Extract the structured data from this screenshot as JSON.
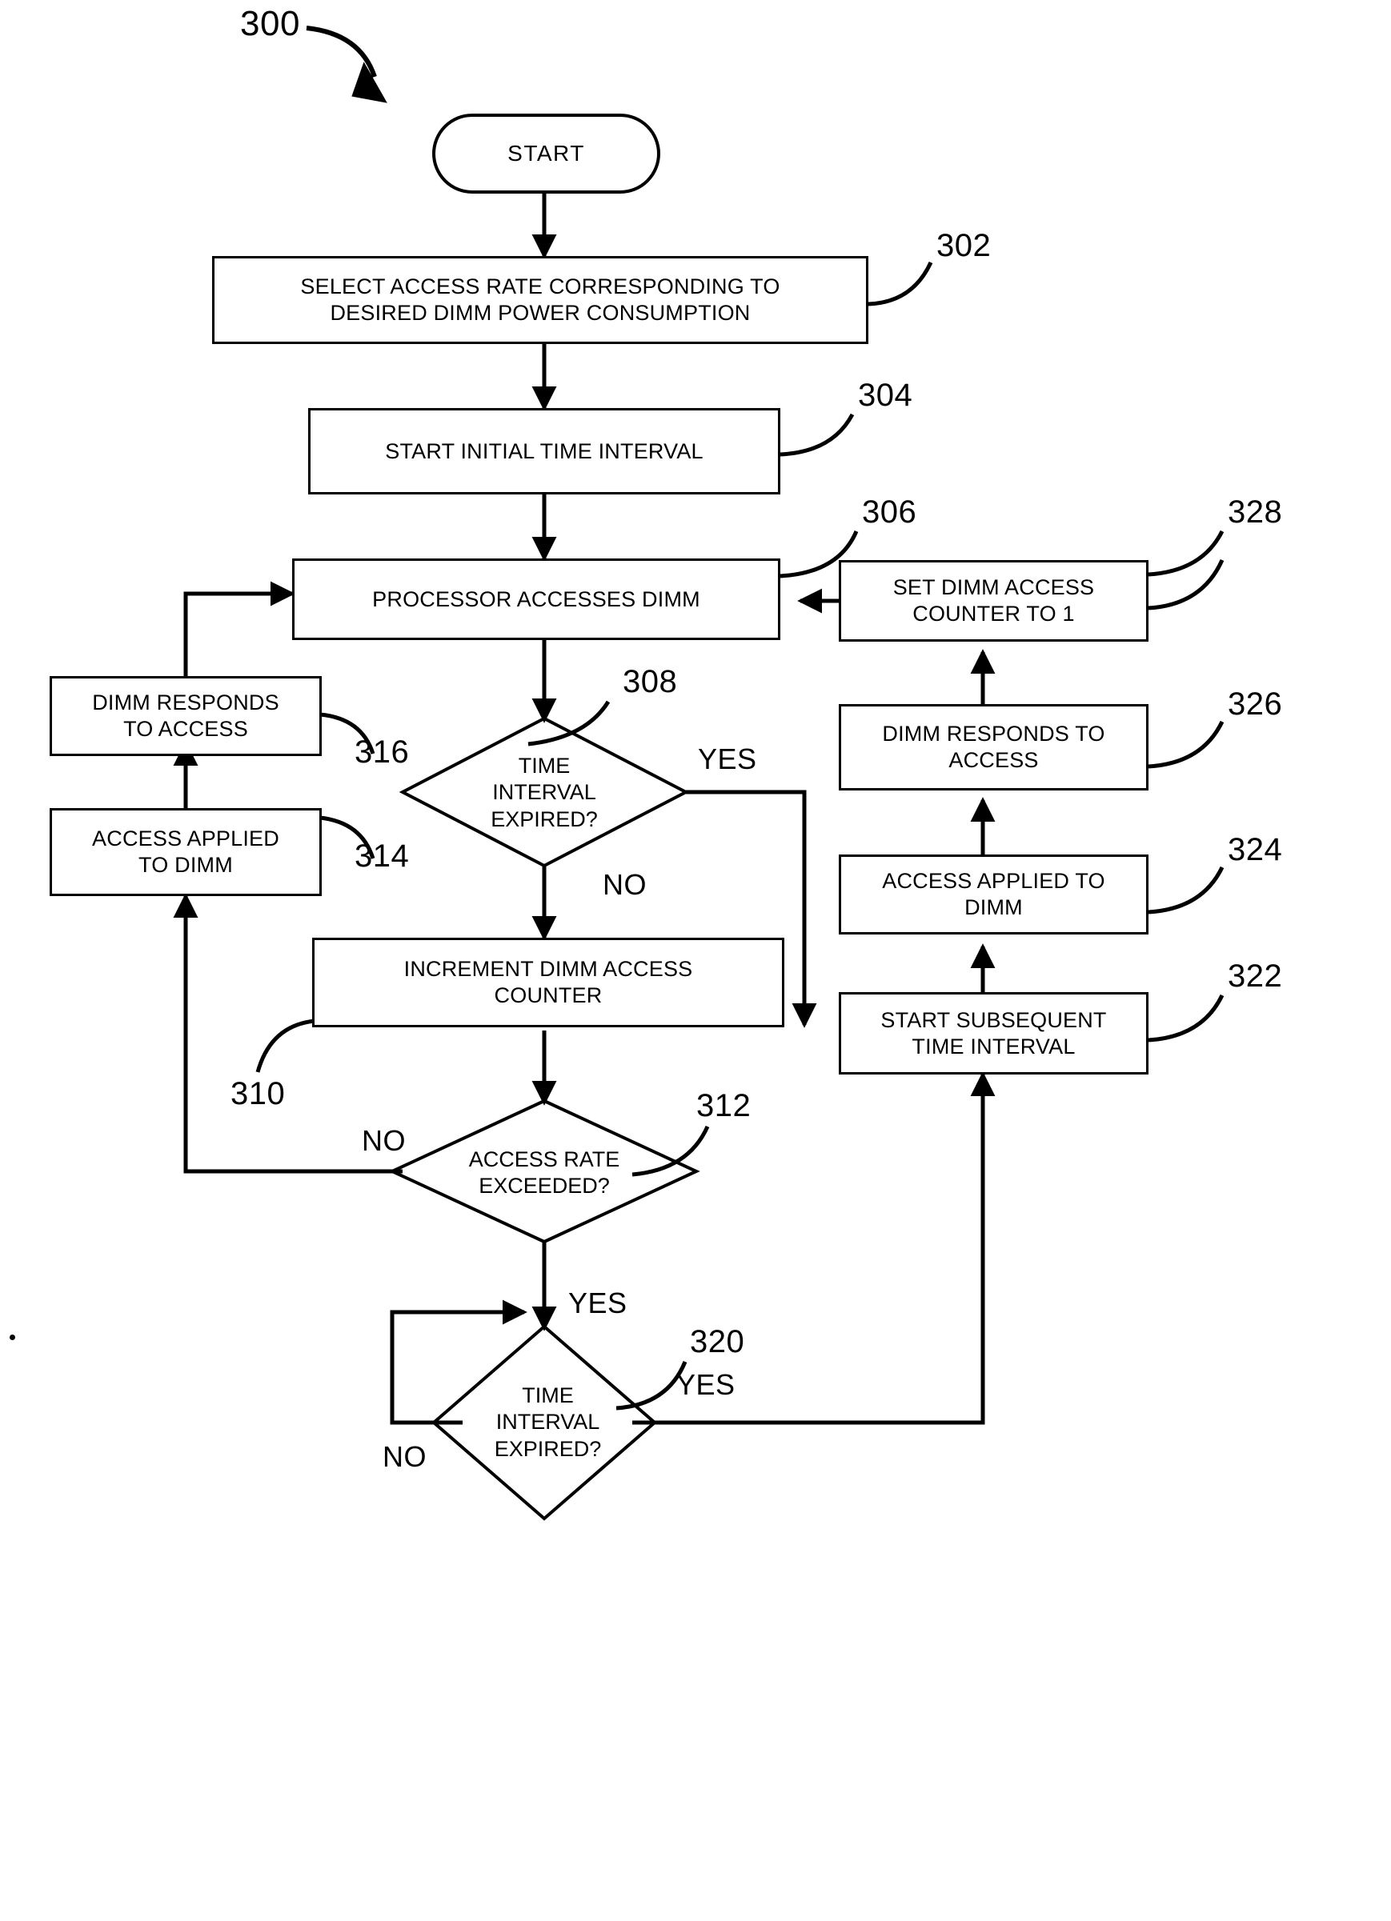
{
  "figure": {
    "number": "300"
  },
  "nodes": {
    "start": {
      "label": "START",
      "shape": "terminal"
    },
    "n302": {
      "label": "SELECT ACCESS RATE CORRESPONDING TO DESIRED DIMM POWER CONSUMPTION",
      "line1": "SELECT ACCESS RATE CORRESPONDING TO",
      "line2": "DESIRED DIMM POWER CONSUMPTION",
      "ref": "302",
      "shape": "process"
    },
    "n304": {
      "label": "START INITIAL TIME INTERVAL",
      "line1": "START INITIAL TIME INTERVAL",
      "line2": "",
      "ref": "304",
      "shape": "process"
    },
    "n306": {
      "label": "PROCESSOR ACCESSES DIMM",
      "line1": "PROCESSOR ACCESSES DIMM",
      "line2": "",
      "ref": "306",
      "shape": "process"
    },
    "n308": {
      "label": "TIME INTERVAL EXPIRED?",
      "line1": "TIME",
      "line2": "INTERVAL",
      "line3": "EXPIRED?",
      "ref": "308",
      "shape": "decision",
      "yes": "YES",
      "no": "NO"
    },
    "n310": {
      "label": "INCREMENT DIMM ACCESS COUNTER",
      "line1": "INCREMENT DIMM ACCESS",
      "line2": "COUNTER",
      "ref": "310",
      "shape": "process"
    },
    "n312": {
      "label": "ACCESS RATE EXCEEDED?",
      "line1": "ACCESS RATE",
      "line2": "EXCEEDED?",
      "ref": "312",
      "shape": "decision",
      "yes": "YES",
      "no": "NO"
    },
    "n314": {
      "label": "ACCESS APPLIED TO DIMM",
      "line1": "ACCESS APPLIED",
      "line2": "TO DIMM",
      "ref": "314",
      "shape": "process"
    },
    "n316": {
      "label": "DIMM RESPONDS TO ACCESS",
      "line1": "DIMM RESPONDS",
      "line2": "TO ACCESS",
      "ref": "316",
      "shape": "process"
    },
    "n320": {
      "label": "TIME INTERVAL EXPIRED?",
      "line1": "TIME",
      "line2": "INTERVAL",
      "line3": "EXPIRED?",
      "ref": "320",
      "shape": "decision",
      "yes": "YES",
      "no": "NO"
    },
    "n322": {
      "label": "START SUBSEQUENT TIME INTERVAL",
      "line1": "START SUBSEQUENT",
      "line2": "TIME INTERVAL",
      "ref": "322",
      "shape": "process"
    },
    "n324": {
      "label": "ACCESS APPLIED TO DIMM",
      "line1": "ACCESS APPLIED TO",
      "line2": "DIMM",
      "ref": "324",
      "shape": "process"
    },
    "n326": {
      "label": "DIMM RESPONDS TO ACCESS",
      "line1": "DIMM RESPONDS TO",
      "line2": "ACCESS",
      "ref": "326",
      "shape": "process"
    },
    "n328": {
      "label": "SET DIMM ACCESS COUNTER TO 1",
      "line1": "SET DIMM ACCESS",
      "line2": "COUNTER TO 1",
      "ref": "328",
      "shape": "process"
    }
  },
  "branch_labels": {
    "d308_yes": "YES",
    "d308_no": "NO",
    "d312_no": "NO",
    "d312_yes": "YES",
    "d320_yes": "YES",
    "d320_no": "NO"
  },
  "colors": {
    "stroke": "#000000",
    "background": "#ffffff"
  }
}
